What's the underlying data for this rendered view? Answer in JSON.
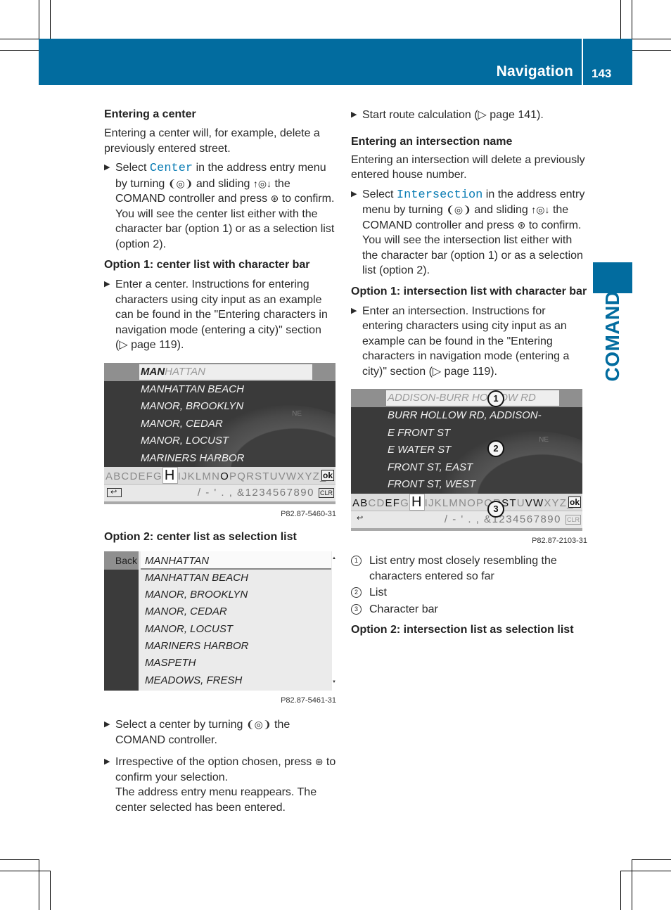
{
  "header": {
    "section_title": "Navigation",
    "page_number": "143"
  },
  "side_tab": {
    "label": "COMAND"
  },
  "colors": {
    "brand_blue": "#026c9f",
    "code_blue": "#0a7cb4"
  },
  "left_column": {
    "center_heading": "Entering a center",
    "center_intro": "Entering a center will, for example, delete a previously entered street.",
    "step1": {
      "pre": "Select",
      "code": "Center",
      "post": "in the address entry menu by turning",
      "turn_icon": "❨◎❩",
      "mid": "and sliding",
      "slide_icon": "↑◎↓",
      "mid2": "the COMAND controller and press",
      "press_icon": "⊛",
      "end": "to confirm.",
      "note": "You will see the center list either with the character bar (option 1) or as a selection list (option 2)."
    },
    "option1_heading": "Option 1: center list with character bar",
    "option1_step": "Enter a center. Instructions for entering characters using city input as an example can be found in the \"Entering characters in navigation mode (entering a city)\" section (▷ page 119).",
    "screen1": {
      "top_entry_typed": "MAN",
      "top_entry_rest": "HATTAN",
      "list": [
        "MANHATTAN BEACH",
        "MANOR, BROOKLYN",
        "MANOR, CEDAR",
        "MANOR, LOCUST",
        "MARINERS HARBOR"
      ],
      "compass_label": "NE",
      "charbar_before": "ABCDEFG",
      "charbar_current": "H",
      "charbar_mid1": "IJKLMN",
      "charbar_available": "O",
      "charbar_after": "PQRSTUVWXYZ_",
      "ok_label": "ok",
      "back_icon": "↩",
      "symbols": "/ - ' . , &1234567890",
      "clr_label": "CLR",
      "caption": "P82.87-5460-31"
    },
    "option2_heading": "Option 2: center list as selection list",
    "screen2": {
      "back_label": "Back",
      "rows": [
        "MANHATTAN",
        "MANHATTAN BEACH",
        "MANOR, BROOKLYN",
        "MANOR, CEDAR",
        "MANOR, LOCUST",
        "MARINERS HARBOR",
        "MASPETH",
        "MEADOWS, FRESH"
      ],
      "caption": "P82.87-5461-31"
    },
    "step_select": {
      "pre": "Select a center by turning",
      "turn_icon": "❨◎❩",
      "post": "the COMAND controller."
    },
    "step_confirm": {
      "pre": "Irrespective of the option chosen, press",
      "press_icon": "⊛",
      "post": "to confirm your selection.",
      "note": "The address entry menu reappears. The center selected has been entered."
    }
  },
  "right_column": {
    "step_route": "Start route calculation (▷ page 141).",
    "intersection_heading": "Entering an intersection name",
    "intersection_intro": "Entering an intersection will delete a previously entered house number.",
    "step1": {
      "pre": "Select",
      "code": "Intersection",
      "post": "in the address entry menu by turning",
      "turn_icon": "❨◎❩",
      "mid": "and sliding",
      "slide_icon": "↑◎↓",
      "mid2": "the COMAND controller and press",
      "press_icon": "⊛",
      "end": "to confirm.",
      "note": "You will see the intersection list either with the character bar (option 1) or as a selection list (option 2)."
    },
    "option1_heading": "Option 1: intersection list with character bar",
    "option1_step": "Enter an intersection. Instructions for entering characters using city input as an example can be found in the \"Entering characters in navigation mode (entering a city)\" section (▷ page 119).",
    "screen3": {
      "top_entry": "ADDISON-BURR HOLLOW RD",
      "list": [
        "BURR HOLLOW RD, ADDISON-",
        "E FRONT ST",
        "E WATER ST",
        "FRONT ST, EAST",
        "FRONT ST, WEST"
      ],
      "compass_label": "NE",
      "charbar_dark1": "AB",
      "charbar_light1": "CD",
      "charbar_dark2": "EF",
      "charbar_light2": "G",
      "charbar_current": "H",
      "charbar_light3": "IJKLMNOPQR",
      "charbar_dark3": "ST",
      "charbar_light4": "U",
      "charbar_dark4": "VW",
      "charbar_light5": "XYZ_",
      "ok_label": "ok",
      "back_icon": "↩",
      "symbols": "/ - ' . , &1234567890",
      "clr_label": "CLR",
      "callouts": [
        "1",
        "2",
        "3"
      ],
      "caption": "P82.87-2103-31"
    },
    "legend": [
      {
        "num": "1",
        "text": "List entry most closely resembling the characters entered so far"
      },
      {
        "num": "2",
        "text": "List"
      },
      {
        "num": "3",
        "text": "Character bar"
      }
    ],
    "option2_heading": "Option 2: intersection list as selection list"
  }
}
